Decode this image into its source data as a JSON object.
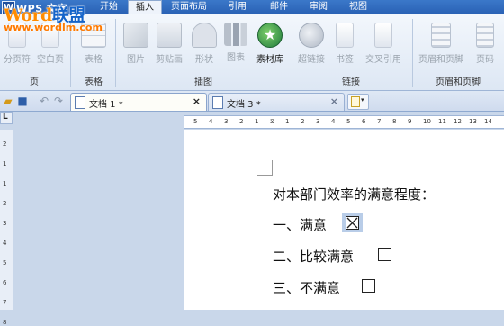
{
  "app": {
    "title": "WPS 文字",
    "badge": "W"
  },
  "watermark": {
    "brand_part1": "Word",
    "brand_part2": "联盟",
    "url": "www.wordlm.com"
  },
  "ribbon_tabs": [
    {
      "label": "开始",
      "active": false
    },
    {
      "label": "插入",
      "active": true
    },
    {
      "label": "页面布局",
      "active": false
    },
    {
      "label": "引用",
      "active": false
    },
    {
      "label": "邮件",
      "active": false
    },
    {
      "label": "审阅",
      "active": false
    },
    {
      "label": "视图",
      "active": false
    }
  ],
  "ribbon": {
    "buttons": [
      {
        "label": "分页符",
        "icon": "page-break-icon",
        "enabled": false
      },
      {
        "label": "空白页",
        "icon": "blank-page-icon",
        "enabled": false
      },
      {
        "label": "表格",
        "icon": "table-icon",
        "enabled": false
      },
      {
        "label": "图片",
        "icon": "picture-icon",
        "enabled": false
      },
      {
        "label": "剪贴画",
        "icon": "clipart-icon",
        "enabled": false
      },
      {
        "label": "形状",
        "icon": "shapes-icon",
        "enabled": false
      },
      {
        "label": "图表",
        "icon": "chart-icon",
        "enabled": false
      },
      {
        "label": "素材库",
        "icon": "material-library-icon",
        "enabled": true
      },
      {
        "label": "超链接",
        "icon": "hyperlink-icon",
        "enabled": false
      },
      {
        "label": "书签",
        "icon": "bookmark-icon",
        "enabled": false
      },
      {
        "label": "交叉引用",
        "icon": "cross-reference-icon",
        "enabled": false
      },
      {
        "label": "页眉和页脚",
        "icon": "header-footer-icon",
        "enabled": false
      },
      {
        "label": "页码",
        "icon": "page-number-icon",
        "enabled": false
      }
    ],
    "groups": [
      "页",
      "表格",
      "插图",
      "链接",
      "页眉和页脚"
    ]
  },
  "document_tabs": [
    {
      "label": "文档 1 *",
      "active": true
    },
    {
      "label": "文档 3 *",
      "active": false
    }
  ],
  "ruler": {
    "corner": "L",
    "h_numbers": [
      "5",
      "4",
      "3",
      "2",
      "1",
      "",
      "1",
      "2",
      "3",
      "4",
      "5",
      "6",
      "7",
      "8",
      "9",
      "10",
      "11",
      "12",
      "13",
      "14"
    ],
    "v_numbers": [
      "2",
      "1",
      "1",
      "2",
      "3",
      "4",
      "5",
      "6",
      "7",
      "8"
    ]
  },
  "document": {
    "question": "对本部门效率的满意程度：",
    "options": [
      {
        "text": "一、满意",
        "checked": true
      },
      {
        "text": "二、比较满意",
        "checked": false
      },
      {
        "text": "三、不满意",
        "checked": false
      }
    ]
  }
}
